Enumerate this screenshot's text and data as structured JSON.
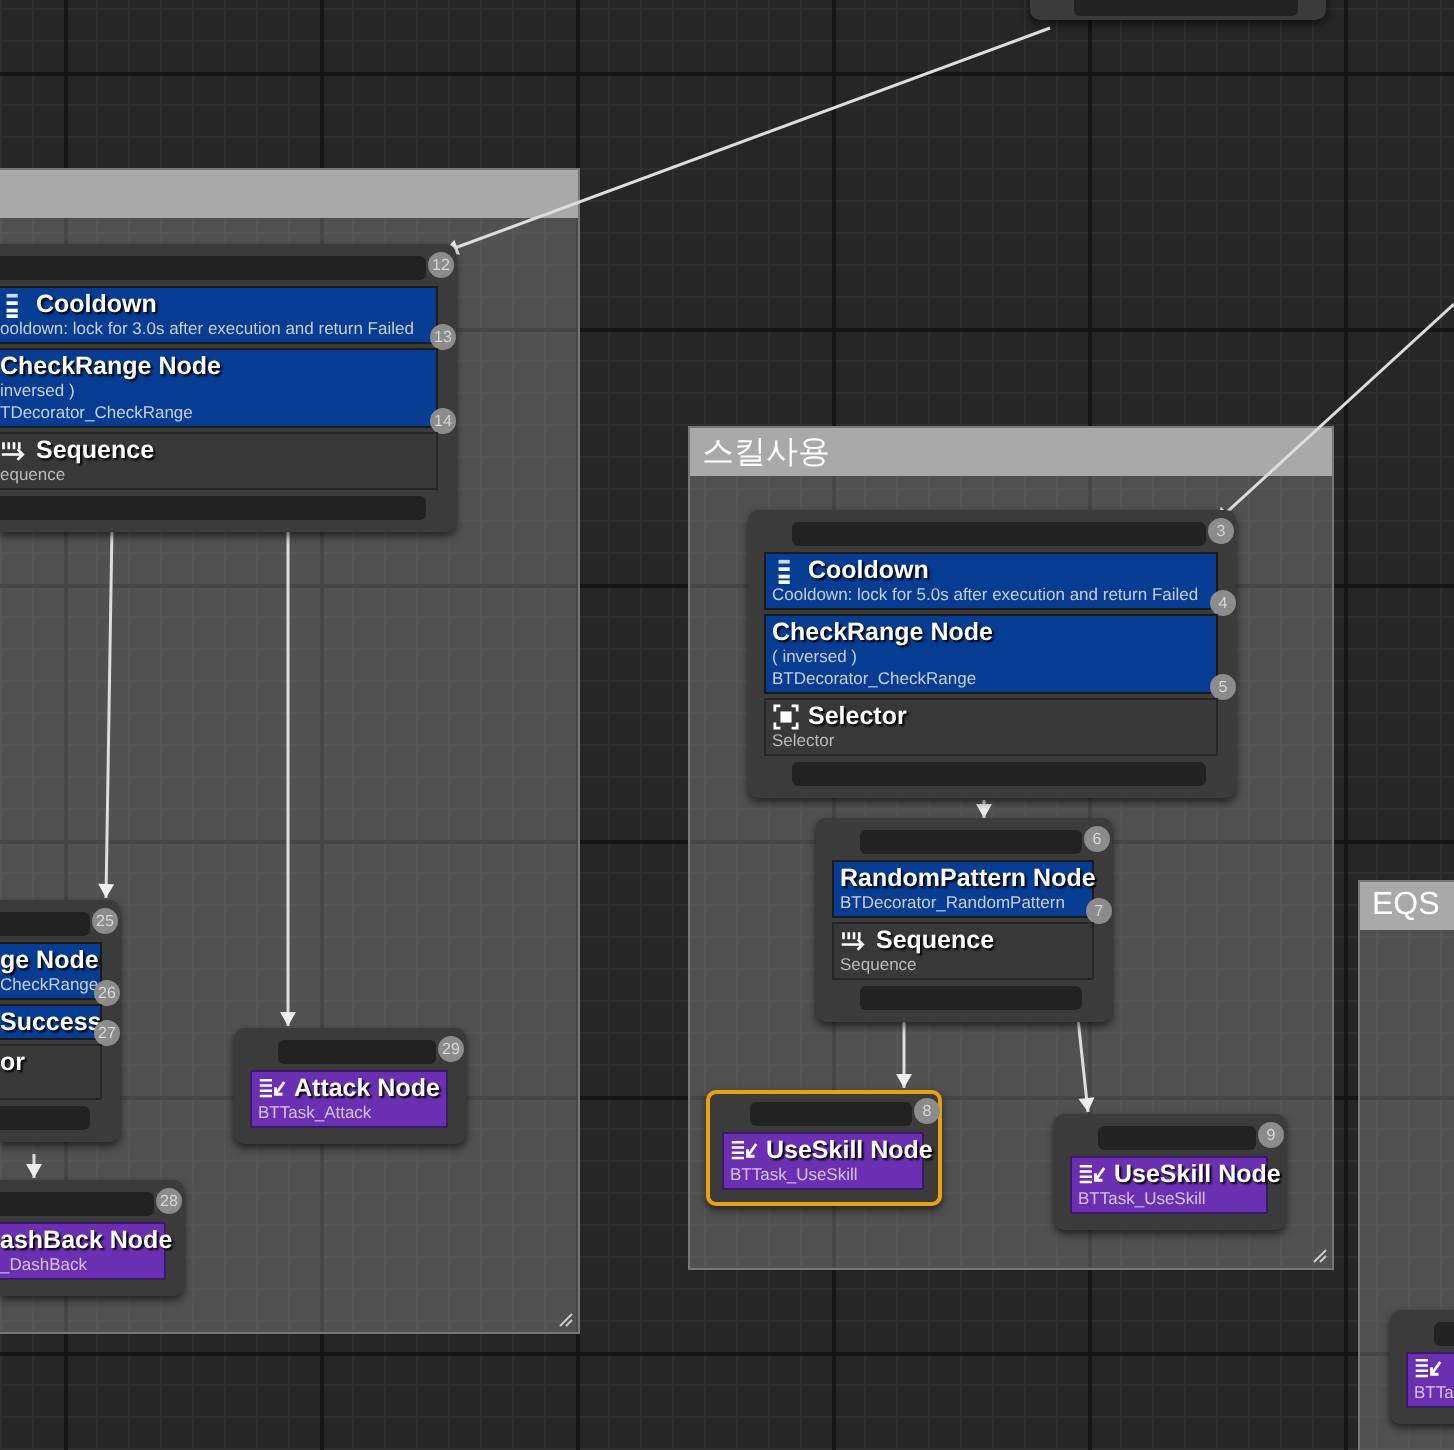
{
  "comments": [
    {
      "title": "스킬사용"
    },
    {
      "title": "EQS"
    }
  ],
  "nodes": [
    {
      "selected": false,
      "badge": "12",
      "items": [
        {
          "kind": "cooldown",
          "title": "Cooldown",
          "lines": [
            "ooldown: lock for 3.0s after execution and return Failed"
          ],
          "badge": "13"
        },
        {
          "kind": "decorator",
          "title": "CheckRange Node",
          "lines": [
            "inversed )",
            "TDecorator_CheckRange"
          ],
          "badge": "14"
        },
        {
          "kind": "sequence",
          "title": "Sequence",
          "lines": [
            "equence"
          ]
        }
      ]
    },
    {
      "selected": false,
      "badge": "25",
      "items": [
        {
          "kind": "decorator",
          "title": "ge Node",
          "lines": [
            "CheckRange"
          ],
          "badge": "26"
        },
        {
          "kind": "decorator",
          "title": "Success",
          "badge": "27"
        },
        {
          "kind": "composite",
          "title": "or"
        }
      ]
    },
    {
      "selected": false,
      "badge": "28",
      "items": [
        {
          "kind": "task",
          "title": "ashBack Node",
          "lines": [
            "_DashBack"
          ]
        }
      ]
    },
    {
      "selected": false,
      "badge": "29",
      "items": [
        {
          "kind": "task",
          "title": "Attack Node",
          "lines": [
            "BTTask_Attack"
          ]
        }
      ]
    },
    {
      "selected": false,
      "badge": "3",
      "items": [
        {
          "kind": "cooldown",
          "title": "Cooldown",
          "lines": [
            "Cooldown: lock for 5.0s after execution and return Failed"
          ],
          "badge": "4"
        },
        {
          "kind": "decorator",
          "title": "CheckRange Node",
          "lines": [
            "( inversed )",
            "BTDecorator_CheckRange"
          ],
          "badge": "5"
        },
        {
          "kind": "selector",
          "title": "Selector",
          "lines": [
            "Selector"
          ]
        }
      ]
    },
    {
      "selected": false,
      "badge": "6",
      "items": [
        {
          "kind": "decorator",
          "title": "RandomPattern Node",
          "lines": [
            "BTDecorator_RandomPattern"
          ],
          "badge": "7"
        },
        {
          "kind": "sequence",
          "title": "Sequence",
          "lines": [
            "Sequence"
          ]
        }
      ]
    },
    {
      "selected": true,
      "badge": "8",
      "items": [
        {
          "kind": "task",
          "title": "UseSkill Node",
          "lines": [
            "BTTask_UseSkill"
          ]
        }
      ]
    },
    {
      "selected": false,
      "badge": "9",
      "items": [
        {
          "kind": "task",
          "title": "UseSkill Node",
          "lines": [
            "BTTask_UseSkill"
          ]
        }
      ]
    },
    {
      "selected": false,
      "items": [
        {
          "kind": "task",
          "lines": [
            "BTTa"
          ]
        }
      ]
    }
  ]
}
